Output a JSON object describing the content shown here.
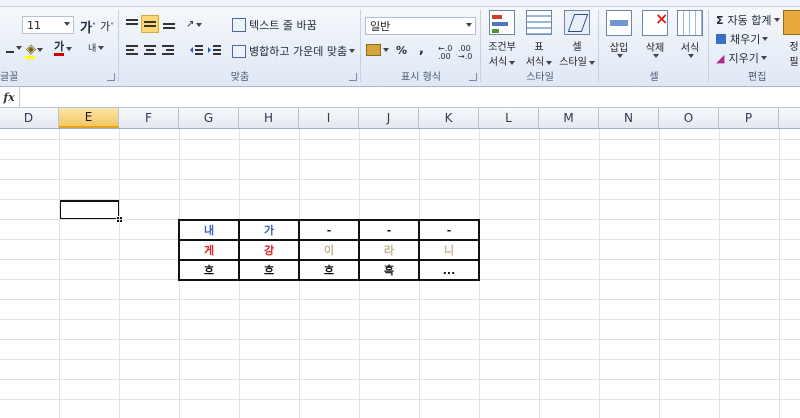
{
  "ribbon": {
    "font": {
      "size_value": "11",
      "grow_label": "가",
      "shrink_label": "가",
      "color_glyph": "가",
      "phonetic_glyph": "내",
      "label": "글꼴"
    },
    "alignment": {
      "wrap_text": "텍스트 줄 바꿈",
      "merge_center": "병합하고 가운데 맞춤",
      "label": "맞춤"
    },
    "number": {
      "format_value": "일반",
      "percent": "%",
      "comma": ",",
      "increase_decimal": "←.0 .00",
      "decrease_decimal": ".00 →.0",
      "label": "표시 형식"
    },
    "styles": {
      "conditional_line1": "조건부",
      "conditional_line2": "서식",
      "table_line1": "표",
      "table_line2": "서식",
      "cell_line1": "셀",
      "cell_line2": "스타일",
      "label": "스타일"
    },
    "cells": {
      "insert": "삽입",
      "delete": "삭제",
      "format": "서식",
      "label": "셀"
    },
    "editing": {
      "autosum": "자동 합계",
      "fill": "채우기",
      "clear": "지우기",
      "sort_line1": "정",
      "sort_line2": "필",
      "label": "편집"
    }
  },
  "formula_bar": {
    "fx_label": "fx",
    "content": ""
  },
  "columns": [
    "D",
    "E",
    "F",
    "G",
    "H",
    "I",
    "J",
    "K",
    "L",
    "M",
    "N",
    "O",
    "P"
  ],
  "selected_column": "E",
  "table": {
    "rows": [
      [
        {
          "text": "내",
          "color": "#3a63b5"
        },
        {
          "text": "가",
          "color": "#3a63b5"
        },
        {
          "text": "-",
          "color": "#111111"
        },
        {
          "text": "-",
          "color": "#111111"
        },
        {
          "text": "-",
          "color": "#111111"
        }
      ],
      [
        {
          "text": "게",
          "color": "#e02020"
        },
        {
          "text": "강",
          "color": "#e02020"
        },
        {
          "text": "이",
          "color": "#c3b48c"
        },
        {
          "text": "라",
          "color": "#c3b48c"
        },
        {
          "text": "니",
          "color": "#c3b48c"
        }
      ],
      [
        {
          "text": "흐",
          "color": "#111111"
        },
        {
          "text": "흐",
          "color": "#111111"
        },
        {
          "text": "흐",
          "color": "#111111"
        },
        {
          "text": "흑",
          "color": "#111111"
        },
        {
          "text": "...",
          "color": "#111111"
        }
      ]
    ]
  }
}
